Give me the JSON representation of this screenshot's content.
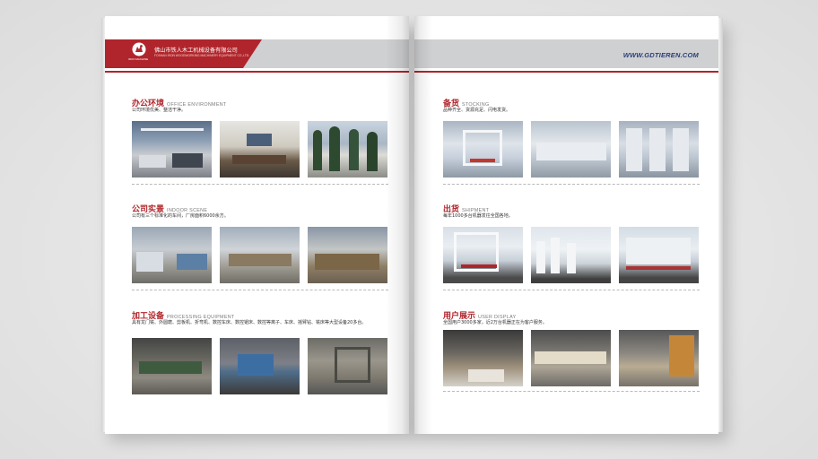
{
  "header": {
    "company_cn": "佛山市铁人木工机械设备有限公司",
    "company_en": "FOSHAN IRON WOODWORKING MACHINERY EQUIPMENT CO.,LTD.",
    "logo_sub": "IRON MACHINE",
    "website": "WWW.GDTIEREN.COM"
  },
  "colors": {
    "accent_red": "#b0252b",
    "header_gray": "#cfd0d2",
    "website_blue": "#2a3f78"
  },
  "left_sections": [
    {
      "title_cn": "办公环境",
      "title_en": "OFFICE ENVIRONMENT",
      "desc": "公司环境优美、整洁干净。"
    },
    {
      "title_cn": "公司实景",
      "title_en": "INDOOR SCENE",
      "desc": "公司有三个标准化的车间，厂房面积6000余方。"
    },
    {
      "title_cn": "加工设备",
      "title_en": "PROCESSING EQUIPMENT",
      "desc": "具有龙门铣、外圆磨、剪板机、折弯机、数控车床、数控锯床、数控等离子、车床、摇臂钻、铣床等大型设备20多台。"
    }
  ],
  "right_sections": [
    {
      "title_cn": "备货",
      "title_en": "STOCKING",
      "desc": "品种齐全、货源充足、闪电发货。"
    },
    {
      "title_cn": "出货",
      "title_en": "SHIPMENT",
      "desc": "每年1000多台机器发往全国各地。"
    },
    {
      "title_cn": "用户展示",
      "title_en": "USER DISPLAY",
      "desc": "全国用户3000多家，近2万台机器正在为客户服务。"
    }
  ]
}
